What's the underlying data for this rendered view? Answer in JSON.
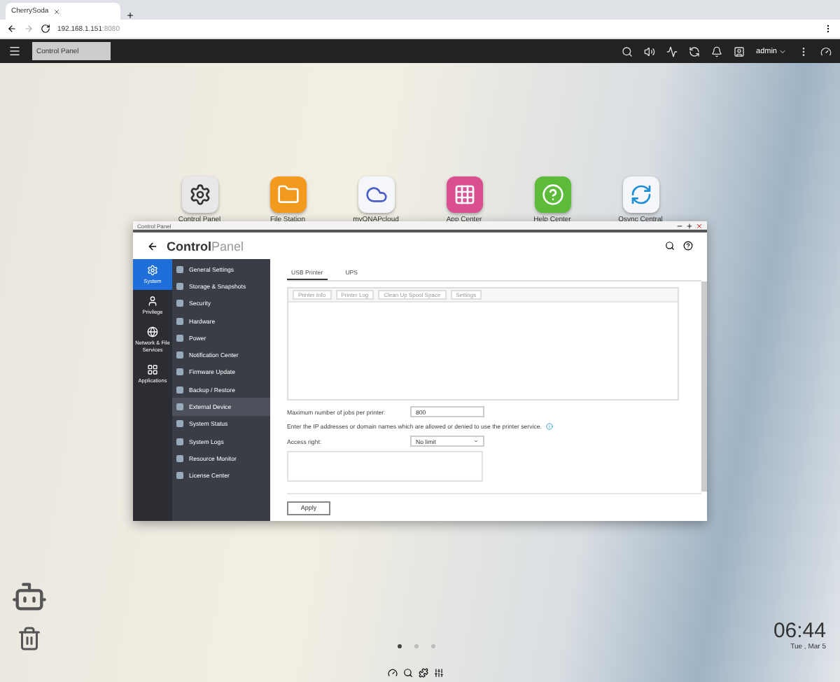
{
  "browser": {
    "tab_title": "CherrySoda",
    "url": "192.168.1.151",
    "url_port": ":8080"
  },
  "taskbar": {
    "tab": "Control Panel",
    "user": "admin"
  },
  "desktop_apps": [
    {
      "label": "Control Panel",
      "kind": "gear",
      "color": "#e8e8e8"
    },
    {
      "label": "File Station",
      "kind": "folder",
      "color": "#f39a1e"
    },
    {
      "label": "myQNAPcloud",
      "kind": "cloud",
      "color": "#f4f6fa"
    },
    {
      "label": "App Center",
      "kind": "grid",
      "color": "#d94f8f"
    },
    {
      "label": "Help Center",
      "kind": "help",
      "color": "#5dbb3a"
    },
    {
      "label": "Qsync Central",
      "kind": "sync",
      "color": "#f4f6fa"
    }
  ],
  "window": {
    "title": "Control Panel",
    "heading_bold": "Control",
    "heading_light": "Panel"
  },
  "categories": [
    {
      "label": "System",
      "kind": "gear",
      "selected": true
    },
    {
      "label": "Privilege",
      "kind": "user",
      "selected": false
    },
    {
      "label": "Network & File Services",
      "kind": "globe",
      "selected": false
    },
    {
      "label": "Applications",
      "kind": "apps",
      "selected": false
    }
  ],
  "menu": [
    {
      "label": "General Settings",
      "selected": false
    },
    {
      "label": "Storage & Snapshots",
      "selected": false
    },
    {
      "label": "Security",
      "selected": false
    },
    {
      "label": "Hardware",
      "selected": false
    },
    {
      "label": "Power",
      "selected": false
    },
    {
      "label": "Notification Center",
      "selected": false
    },
    {
      "label": "Firmware Update",
      "selected": false
    },
    {
      "label": "Backup / Restore",
      "selected": false
    },
    {
      "label": "External Device",
      "selected": true
    },
    {
      "label": "System Status",
      "selected": false
    },
    {
      "label": "System Logs",
      "selected": false
    },
    {
      "label": "Resource Monitor",
      "selected": false
    },
    {
      "label": "License Center",
      "selected": false
    }
  ],
  "tabs": [
    {
      "label": "USB Printer",
      "selected": true
    },
    {
      "label": "UPS",
      "selected": false
    }
  ],
  "toolbar": [
    "Printer Info",
    "Printer Log",
    "Clean Up Spool Space",
    "Settings"
  ],
  "form": {
    "max_jobs_label": "Maximum number of jobs per printer:",
    "max_jobs_value": "800",
    "ip_note": "Enter the IP addresses or domain names which are allowed or denied to use the printer service.",
    "access_label": "Access right:",
    "access_value": "No limit"
  },
  "apply": "Apply",
  "clock": {
    "time": "06:44",
    "date": "Tue , Mar 5"
  },
  "pager": [
    {
      "selected": true
    },
    {
      "selected": false
    },
    {
      "selected": false
    }
  ]
}
